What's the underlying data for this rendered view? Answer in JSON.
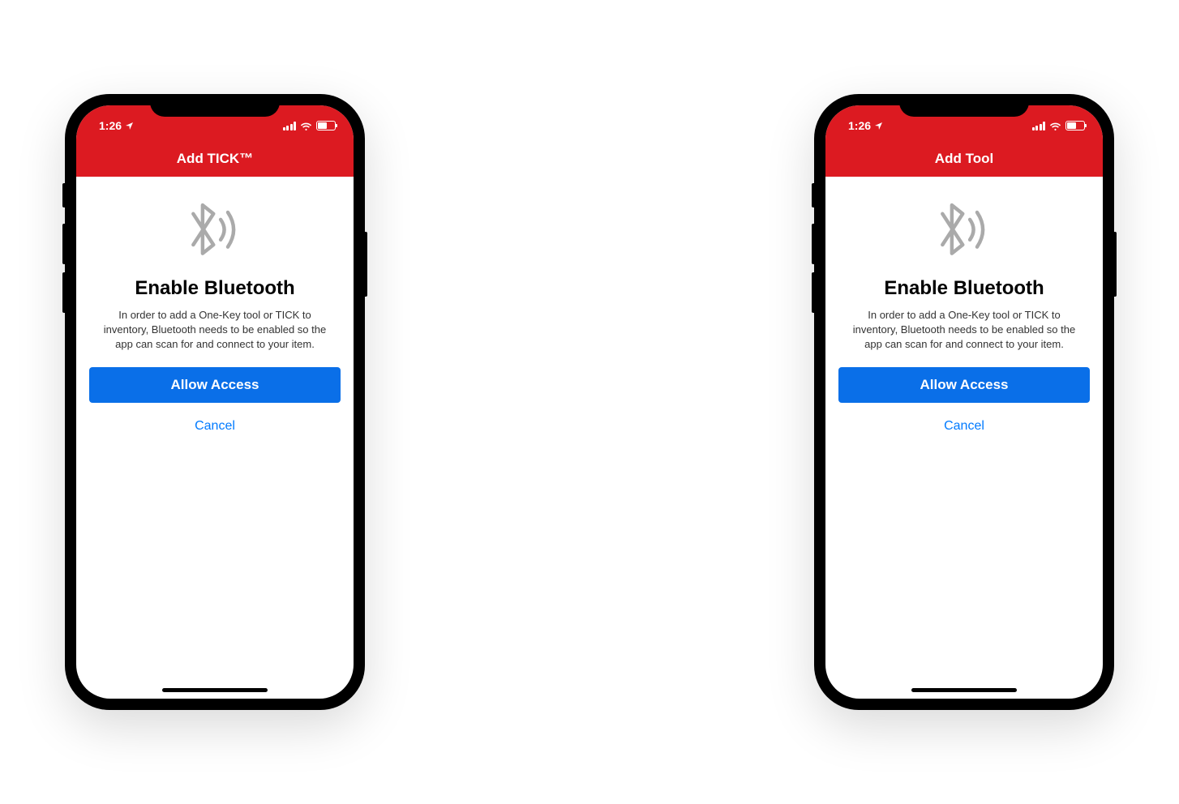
{
  "status_bar": {
    "time": "1:26"
  },
  "phones": [
    {
      "nav_title": "Add TICK™",
      "heading": "Enable Bluetooth",
      "description": "In order to add a One-Key tool or TICK to inventory, Bluetooth needs to be enabled so the app can scan for and connect to your item.",
      "primary_button": "Allow Access",
      "cancel_button": "Cancel"
    },
    {
      "nav_title": "Add Tool",
      "heading": "Enable Bluetooth",
      "description": "In order to add a One-Key tool or TICK to inventory, Bluetooth needs to be enabled so the app can scan for and connect to your item.",
      "primary_button": "Allow Access",
      "cancel_button": "Cancel"
    }
  ]
}
